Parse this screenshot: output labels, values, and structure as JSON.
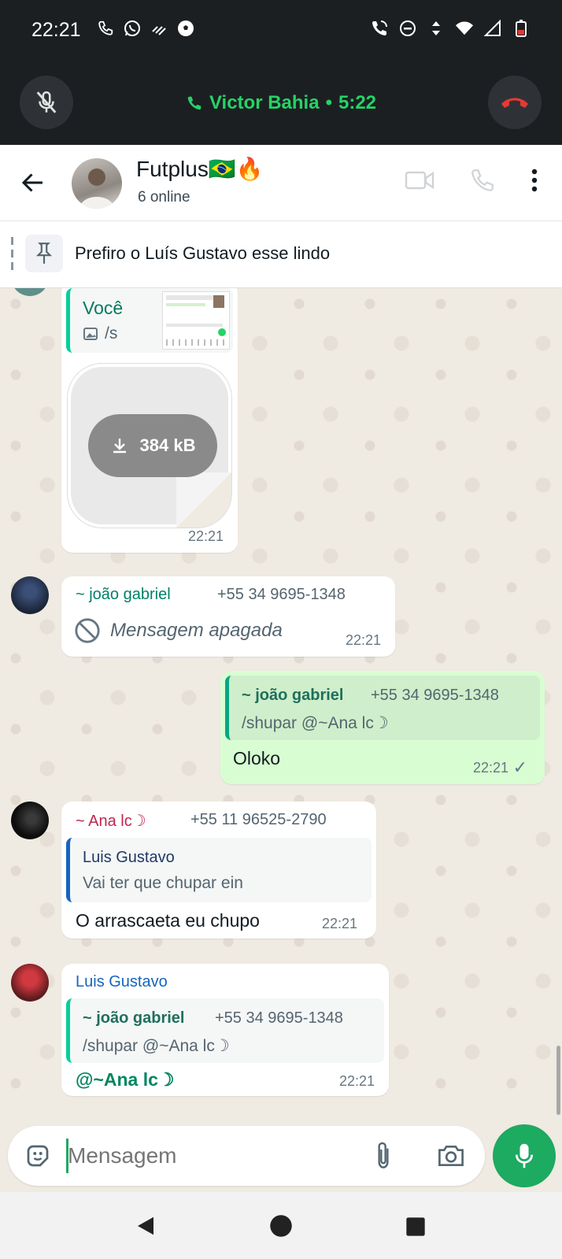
{
  "status_bar": {
    "time": "22:21",
    "left_icons": [
      "phone-icon",
      "whatsapp-icon",
      "signal-bars-icon",
      "soccer-ball-icon"
    ],
    "right_icons": [
      "wifi-calling-icon",
      "do-not-disturb-icon",
      "data-arrows-icon",
      "wifi-icon",
      "cell-signal-icon",
      "battery-icon"
    ]
  },
  "call_bar": {
    "contact": "Victor Bahia",
    "separator": "•",
    "duration": "5:22",
    "accent": "#25d366"
  },
  "header": {
    "title": "Futplus🇧🇷🔥",
    "subtitle": "6 online"
  },
  "pinned": {
    "text": "Prefiro o Luís Gustavo esse lindo"
  },
  "messages": [
    {
      "quote_name": "Você",
      "quote_text": "/s",
      "file_size": "384 kB",
      "time": "22:21"
    },
    {
      "sender": "~ joão gabriel",
      "phone": "+55 34 9695-1348",
      "text": "Mensagem apagada",
      "time": "22:21"
    },
    {
      "quote_name": "~ joão gabriel",
      "quote_phone": "+55 34 9695-1348",
      "quote_text": "/shupar @~Ana lc☽",
      "text": "Oloko",
      "time": "22:21",
      "status": "✓"
    },
    {
      "sender": "~ Ana lc☽",
      "phone": "+55 11 96525-2790",
      "quote_name": "Luis Gustavo",
      "quote_text": "Vai ter que chupar ein",
      "text": "O arrascaeta eu chupo",
      "time": "22:21"
    },
    {
      "sender": "Luis Gustavo",
      "quote_name": "~ joão gabriel",
      "quote_phone": "+55 34 9695-1348",
      "quote_text": "/shupar @~Ana lc☽",
      "text": "@~Ana lc☽",
      "time": "22:21"
    }
  ],
  "composer": {
    "placeholder": "Mensagem"
  },
  "colors": {
    "chat_bg": "#efeae2",
    "outgoing_bubble": "#d9fdd3",
    "mic_button": "#1daa61",
    "end_call": "#e53935"
  }
}
